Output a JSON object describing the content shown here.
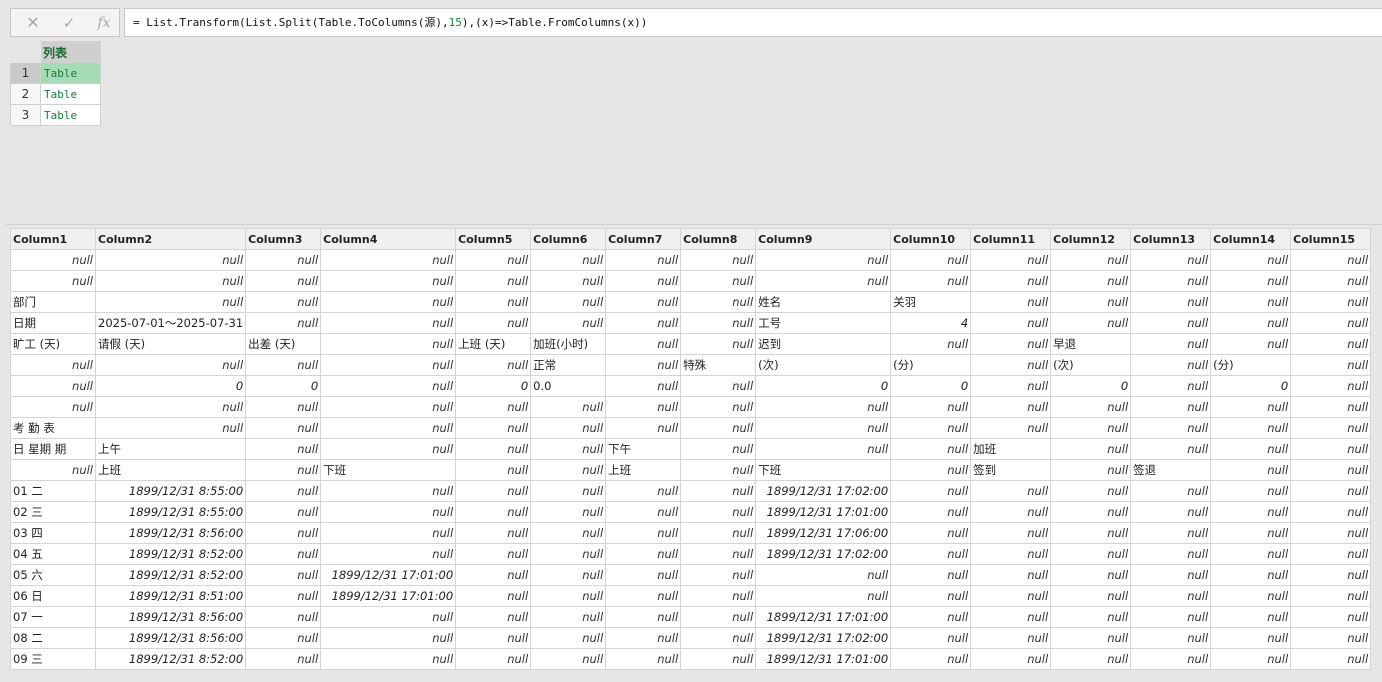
{
  "formula_bar": {
    "cancel_icon": "close-icon",
    "confirm_icon": "check-icon",
    "fx_label": "fx",
    "formula_pre": "= List.Transform(List.Split(Table.ToColumns(源),",
    "formula_num": "15",
    "formula_post": "),(x)=>Table.FromColumns(x))"
  },
  "list_table": {
    "header": "列表",
    "rows": [
      {
        "num": "1",
        "value": "Table",
        "selected": true
      },
      {
        "num": "2",
        "value": "Table",
        "selected": false
      },
      {
        "num": "3",
        "value": "Table",
        "selected": false
      }
    ]
  },
  "preview": {
    "columns": [
      "Column1",
      "Column2",
      "Column3",
      "Column4",
      "Column5",
      "Column6",
      "Column7",
      "Column8",
      "Column9",
      "Column10",
      "Column11",
      "Column12",
      "Column13",
      "Column14",
      "Column15"
    ],
    "rows": [
      [
        "null",
        "null",
        "null",
        "null",
        "null",
        "null",
        "null",
        "null",
        "null",
        "null",
        "null",
        "null",
        "null",
        "null",
        "null"
      ],
      [
        "null",
        "null",
        "null",
        "null",
        "null",
        "null",
        "null",
        "null",
        "null",
        "null",
        "null",
        "null",
        "null",
        "null",
        "null"
      ],
      [
        "部门",
        "null",
        "null",
        "null",
        "null",
        "null",
        "null",
        "null",
        "姓名",
        "关羽",
        "null",
        "null",
        "null",
        "null",
        "null"
      ],
      [
        "日期",
        "2025-07-01～2025-07-31",
        "null",
        "null",
        "null",
        "null",
        "null",
        "null",
        "工号",
        "4",
        "null",
        "null",
        "null",
        "null",
        "null"
      ],
      [
        "旷工 (天)",
        "请假 (天)",
        "出差 (天)",
        "null",
        "上班 (天)",
        "加班(小时)",
        "null",
        "null",
        "迟到",
        "null",
        "null",
        "早退",
        "null",
        "null",
        "null"
      ],
      [
        "null",
        "null",
        "null",
        "null",
        "null",
        "正常",
        "null",
        "特殊",
        "(次)",
        "(分)",
        "null",
        "(次)",
        "null",
        "(分)",
        "null"
      ],
      [
        "null",
        "0",
        "0",
        "null",
        "0",
        "0.0",
        "null",
        "null",
        "0",
        "0",
        "null",
        "0",
        "null",
        "0",
        "null"
      ],
      [
        "null",
        "null",
        "null",
        "null",
        "null",
        "null",
        "null",
        "null",
        "null",
        "null",
        "null",
        "null",
        "null",
        "null",
        "null"
      ],
      [
        "考 勤 表",
        "null",
        "null",
        "null",
        "null",
        "null",
        "null",
        "null",
        "null",
        "null",
        "null",
        "null",
        "null",
        "null",
        "null"
      ],
      [
        "日 星期 期",
        "上午",
        "null",
        "null",
        "null",
        "null",
        "下午",
        "null",
        "null",
        "null",
        "加班",
        "null",
        "null",
        "null",
        "null"
      ],
      [
        "null",
        "上班",
        "null",
        "下班",
        "null",
        "null",
        "上班",
        "null",
        "下班",
        "null",
        "签到",
        "null",
        "签退",
        "null",
        "null"
      ],
      [
        "01 二",
        "1899/12/31 8:55:00",
        "null",
        "null",
        "null",
        "null",
        "null",
        "null",
        "1899/12/31 17:02:00",
        "null",
        "null",
        "null",
        "null",
        "null",
        "null"
      ],
      [
        "02 三",
        "1899/12/31 8:55:00",
        "null",
        "null",
        "null",
        "null",
        "null",
        "null",
        "1899/12/31 17:01:00",
        "null",
        "null",
        "null",
        "null",
        "null",
        "null"
      ],
      [
        "03 四",
        "1899/12/31 8:56:00",
        "null",
        "null",
        "null",
        "null",
        "null",
        "null",
        "1899/12/31 17:06:00",
        "null",
        "null",
        "null",
        "null",
        "null",
        "null"
      ],
      [
        "04 五",
        "1899/12/31 8:52:00",
        "null",
        "null",
        "null",
        "null",
        "null",
        "null",
        "1899/12/31 17:02:00",
        "null",
        "null",
        "null",
        "null",
        "null",
        "null"
      ],
      [
        "05 六",
        "1899/12/31 8:52:00",
        "null",
        "1899/12/31 17:01:00",
        "null",
        "null",
        "null",
        "null",
        "null",
        "null",
        "null",
        "null",
        "null",
        "null",
        "null"
      ],
      [
        "06 日",
        "1899/12/31 8:51:00",
        "null",
        "1899/12/31 17:01:00",
        "null",
        "null",
        "null",
        "null",
        "null",
        "null",
        "null",
        "null",
        "null",
        "null",
        "null"
      ],
      [
        "07 一",
        "1899/12/31 8:56:00",
        "null",
        "null",
        "null",
        "null",
        "null",
        "null",
        "1899/12/31 17:01:00",
        "null",
        "null",
        "null",
        "null",
        "null",
        "null"
      ],
      [
        "08 二",
        "1899/12/31 8:56:00",
        "null",
        "null",
        "null",
        "null",
        "null",
        "null",
        "1899/12/31 17:02:00",
        "null",
        "null",
        "null",
        "null",
        "null",
        "null"
      ],
      [
        "09 三",
        "1899/12/31 8:52:00",
        "null",
        "null",
        "null",
        "null",
        "null",
        "null",
        "1899/12/31 17:01:00",
        "null",
        "null",
        "null",
        "null",
        "null",
        "null"
      ]
    ]
  }
}
